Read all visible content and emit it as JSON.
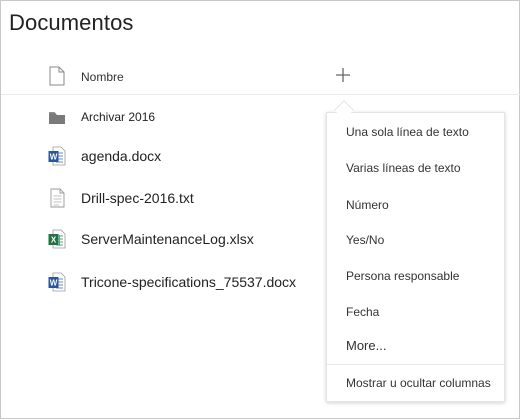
{
  "page": {
    "title": "Documentos"
  },
  "list": {
    "column_header": "Nombre",
    "add_column_icon": "plus-icon",
    "files": [
      {
        "name": "Archivar 2016",
        "icon": "folder-icon"
      },
      {
        "name": "agenda.docx",
        "icon": "word-doc-icon"
      },
      {
        "name": "Drill-spec-2016.txt",
        "icon": "text-file-icon"
      },
      {
        "name": "ServerMaintenanceLog.xlsx",
        "icon": "excel-doc-icon"
      },
      {
        "name": "Tricone-specifications_75537.docx",
        "icon": "word-doc-icon"
      }
    ]
  },
  "column_menu": {
    "items": [
      "Una sola línea de texto",
      "Varias líneas de texto",
      "Número",
      "Yes/No",
      "Persona responsable",
      "Fecha",
      "More..."
    ],
    "footer_item": "Mostrar u ocultar columnas"
  },
  "colors": {
    "word_blue": "#2b579a",
    "excel_green": "#217346",
    "folder_gray": "#7a7a7a",
    "text": "#333333"
  }
}
